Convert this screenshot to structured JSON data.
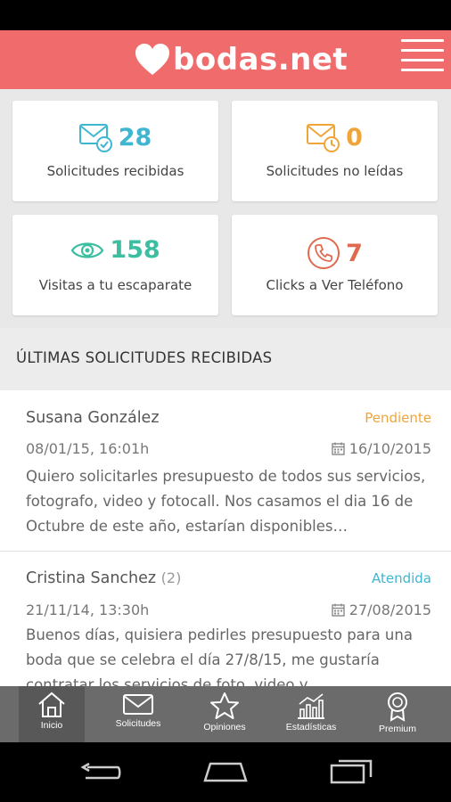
{
  "app": {
    "brand": "bodas.net",
    "brand_color": "#f06c6c"
  },
  "stats": [
    {
      "icon": "envelope-check-icon",
      "value": "28",
      "label": "Solicitudes recibidas",
      "color": "#3fb6d1"
    },
    {
      "icon": "envelope-clock-icon",
      "value": "0",
      "label": "Solicitudes no leídas",
      "color": "#f0a53a"
    },
    {
      "icon": "eye-icon",
      "value": "158",
      "label": "Visitas a tu escaparate",
      "color": "#3cbfa0"
    },
    {
      "icon": "phone-icon",
      "value": "7",
      "label": "Clicks a Ver Teléfono",
      "color": "#e06a4e"
    }
  ],
  "section": {
    "title": "ÚLTIMAS SOLICITUDES RECIBIDAS"
  },
  "requests": [
    {
      "name": "Susana González",
      "count": "",
      "status": "Pendiente",
      "status_color": "#f0a53a",
      "received": "08/01/15, 16:01h",
      "event_date": "16/10/2015",
      "message": "Quiero solicitarles presupuesto de todos sus servicios, fotografo, video y fotocall. Nos casamos el dia 16 de Octubre de este año, estarían disponibles…"
    },
    {
      "name": "Cristina Sanchez",
      "count": "(2)",
      "status": "Atendida",
      "status_color": "#3fb6d1",
      "received": "21/11/14, 13:30h",
      "event_date": "27/08/2015",
      "message": "Buenos días, quisiera pedirles presupuesto para una boda que se celebra el día 27/8/15, me gustaría contratar los servicios de foto, video y"
    }
  ],
  "tabs": [
    {
      "icon": "home-icon",
      "label": "Inicio",
      "active": true
    },
    {
      "icon": "envelope-icon",
      "label": "Solicitudes",
      "active": false
    },
    {
      "icon": "star-icon",
      "label": "Opiniones",
      "active": false
    },
    {
      "icon": "chart-icon",
      "label": "Estadísticas",
      "active": false
    },
    {
      "icon": "ribbon-icon",
      "label": "Premium",
      "active": false
    }
  ]
}
